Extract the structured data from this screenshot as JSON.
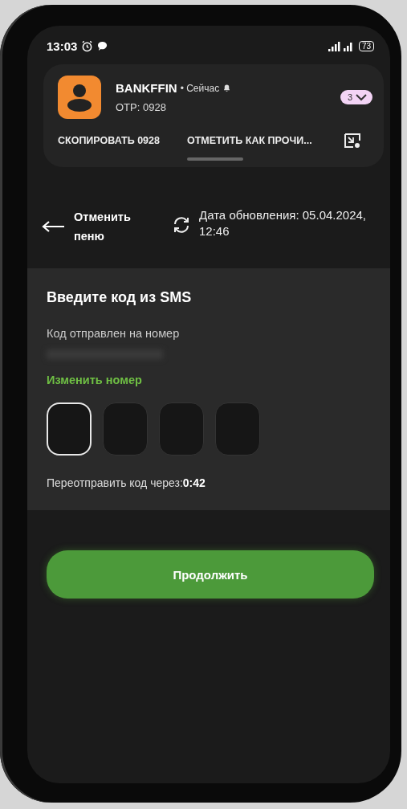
{
  "status_bar": {
    "time": "13:03",
    "battery": "73"
  },
  "notification": {
    "sender": "BANKFFIN",
    "time": "• Сейчас",
    "body": "OTP: 0928",
    "count": "3",
    "actions": [
      {
        "label": "СКОПИРОВАТЬ 0928"
      },
      {
        "label": "ОТМЕТИТЬ КАК ПРОЧИ..."
      }
    ]
  },
  "header": {
    "back_label": "Отменить пеню",
    "update_label": "Дата обновления: 05.04.2024, 12:46"
  },
  "sms_card": {
    "title": "Введите код из SMS",
    "subtitle": "Код отправлен на номер",
    "change_link": "Изменить номер",
    "code_boxes": [
      {
        "selected": true
      },
      {
        "selected": false
      },
      {
        "selected": false
      },
      {
        "selected": false
      }
    ],
    "resend_label": "Переотправить код через:",
    "resend_timer": "0:42"
  },
  "continue_button": {
    "label": "Продолжить"
  }
}
